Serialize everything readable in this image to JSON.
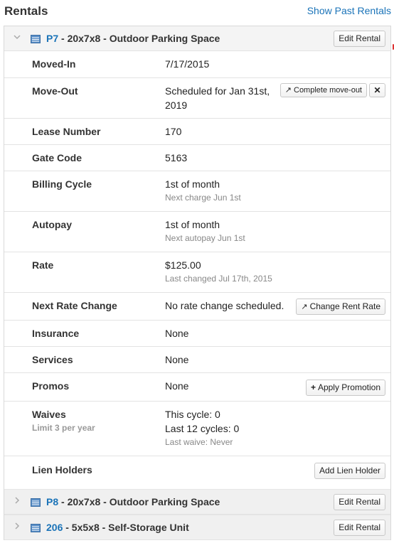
{
  "header": {
    "title": "Rentals",
    "past_link": "Show Past Rentals"
  },
  "rentals": [
    {
      "unit_id": "P7",
      "description": " - 20x7x8 - Outdoor Parking Space",
      "edit_label": "Edit Rental",
      "expanded": true
    },
    {
      "unit_id": "P8",
      "description": " - 20x7x8 - Outdoor Parking Space",
      "edit_label": "Edit Rental",
      "expanded": false
    },
    {
      "unit_id": "206",
      "description": " - 5x5x8 - Self-Storage Unit",
      "edit_label": "Edit Rental",
      "expanded": false
    }
  ],
  "details": {
    "moved_in": {
      "label": "Moved-In",
      "value": "7/17/2015"
    },
    "move_out": {
      "label": "Move-Out",
      "value_line1": "Scheduled for Jan 31st,",
      "value_line2": "2019",
      "complete_label": "Complete move-out",
      "cancel_glyph": "✕"
    },
    "lease_number": {
      "label": "Lease Number",
      "value": "170"
    },
    "gate_code": {
      "label": "Gate Code",
      "value": "5163"
    },
    "billing_cycle": {
      "label": "Billing Cycle",
      "value": "1st of month",
      "sub": "Next charge Jun 1st"
    },
    "autopay": {
      "label": "Autopay",
      "value": "1st of month",
      "sub": "Next autopay Jun 1st"
    },
    "rate": {
      "label": "Rate",
      "value": "$125.00",
      "sub": "Last changed Jul 17th, 2015"
    },
    "next_rate_change": {
      "label": "Next Rate Change",
      "value": "No rate change scheduled.",
      "button": "Change Rent Rate"
    },
    "insurance": {
      "label": "Insurance",
      "value": "None"
    },
    "services": {
      "label": "Services",
      "value": "None"
    },
    "promos": {
      "label": "Promos",
      "value": "None",
      "button": "Apply Promotion"
    },
    "waives": {
      "label": "Waives",
      "sublabel": "Limit 3 per year",
      "line1": "This cycle: 0",
      "line2": "Last 12 cycles: 0",
      "sub": "Last waive: Never"
    },
    "lien_holders": {
      "label": "Lien Holders",
      "button": "Add Lien Holder"
    }
  },
  "colors": {
    "link": "#1a73b8",
    "header_bg": "#f4f4f4",
    "muted": "#888888"
  }
}
